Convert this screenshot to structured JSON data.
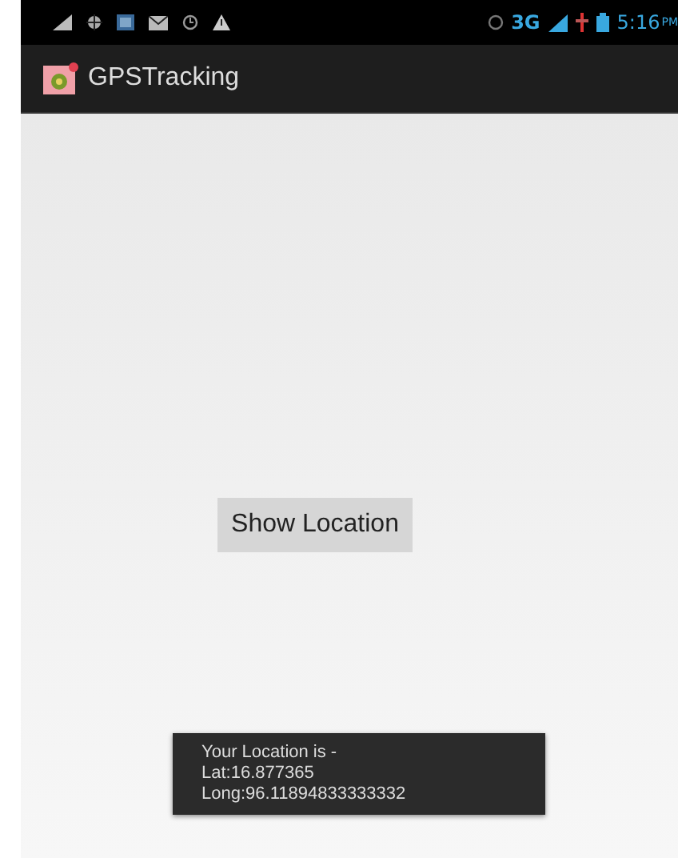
{
  "status_bar": {
    "network": "3G",
    "time": "5:16",
    "meridiem": "PM"
  },
  "action_bar": {
    "title": "GPSTracking"
  },
  "button": {
    "label": "Show Location"
  },
  "toast": {
    "lines": [
      "Your Location is -",
      "Lat:16.877365",
      "Long:96.11894833333332"
    ]
  }
}
